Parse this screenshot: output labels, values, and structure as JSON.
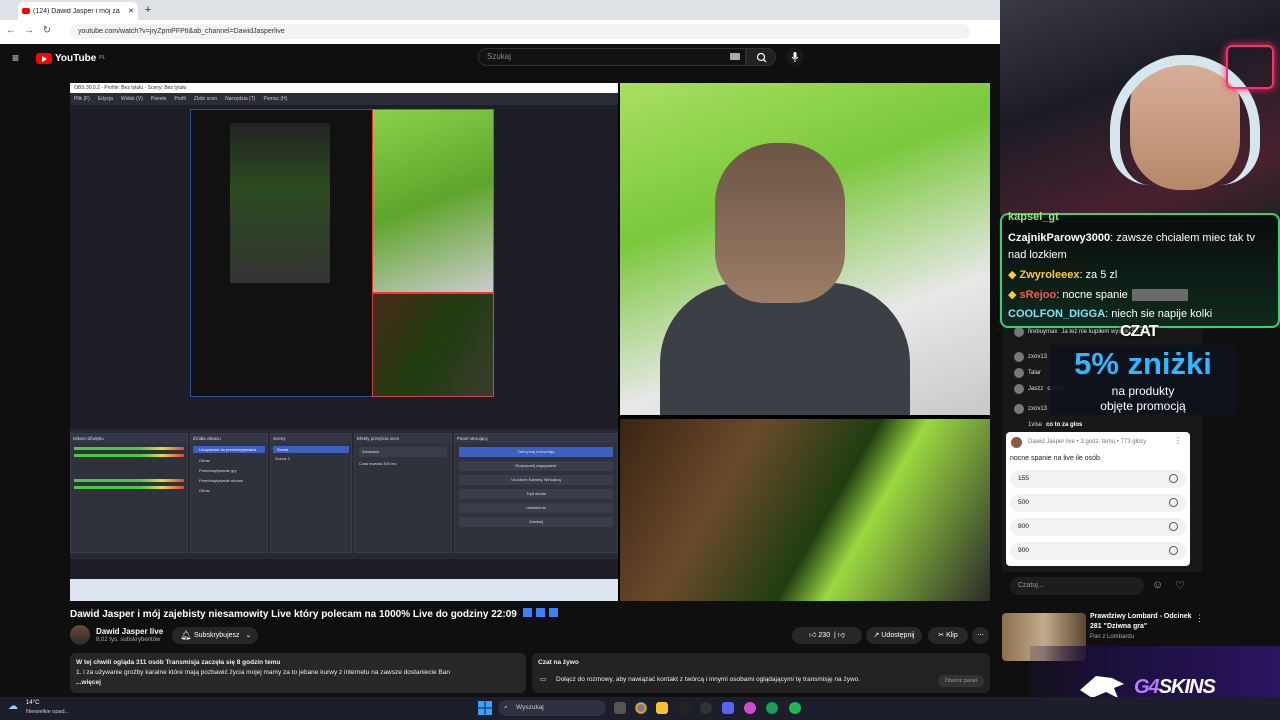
{
  "browser": {
    "tab_title": "(124) Dawid Jasper i mój za",
    "url": "youtube.com/watch?v=jryZpmPFPtI&ab_channel=DawidJasperlive"
  },
  "youtube": {
    "logo": "YouTube",
    "logo_country": "PL",
    "search_placeholder": "Szukaj"
  },
  "obs": {
    "title": "OBS 30.0.2 - Profile: Bez tytułu - Sceny: Bez tytułu",
    "menu": [
      "Plik (F)",
      "Edycja",
      "Widok (V)",
      "Panele",
      "Profil",
      "Zbiór scen",
      "Narzędzia (T)",
      "Pomoc (H)"
    ],
    "docks": [
      "Mikser dźwięku",
      "Źródła obrazu",
      "Sceny",
      "Efekty przejścia scen",
      "Panel sterujący"
    ],
    "scene_selected": "Scena",
    "scene_2": "Scena 3",
    "transition": "Zanikanie",
    "duration_label": "Czas trwania",
    "duration_value": "300 ms",
    "controls": [
      "Zatrzymaj transmisję",
      "Rozpocznij nagrywanie",
      "Uruchom Kamerę Wirtualną",
      "Tryb studia",
      "Ustawienia",
      "Zamknij"
    ],
    "sources": [
      "Urządzenie do przechwytywania",
      "Obraz",
      "Przechwytywanie gry",
      "Przechwytywanie ekranu",
      "Obraz"
    ]
  },
  "overlay_chat": {
    "lines": [
      {
        "name": "kapsel_gt",
        "text": "",
        "color": "#9be96b"
      },
      {
        "name": "CzajnikParowy3000",
        "text": ": zawsze chcialem miec tak tv",
        "color": "#ffffff"
      },
      {
        "name": "",
        "text": "nad lozkiem",
        "color": "#ffffff"
      },
      {
        "name": "Zwyroleeex",
        "text": ": za 5 zl",
        "color": "#ffcc33"
      },
      {
        "name": "sRejoo",
        "text": ": nocne spanie",
        "color": "#ff5555"
      },
      {
        "name": "COOLFON_DIGGA",
        "text": ": niech sie napije kolki",
        "color": "#7fe3ff"
      }
    ],
    "label": "CZAT"
  },
  "yt_chat_rows": [
    {
      "name": "firebuymax",
      "text": "Ja też nie kupiłem wysyłki 50 zł"
    },
    {
      "name": "zxov13",
      "text": ""
    },
    {
      "name": "Talar",
      "text": ""
    },
    {
      "name": "Jaszz",
      "text": "opozn"
    },
    {
      "name": "zxov13",
      "text": ""
    },
    {
      "name": "1vise",
      "text": "co to za glos"
    }
  ],
  "promo": {
    "big": "5% zniżki",
    "line1": "na produkty",
    "line2": "objęte promocją"
  },
  "poll": {
    "meta": "Dawid Jasper live • 3 godz. temu • 773 głosy",
    "question": "nocne spanie na live ile osób",
    "options": [
      "155",
      "500",
      "800",
      "900"
    ]
  },
  "chat_input_placeholder": "Czatuj...",
  "video": {
    "title": "Dawid Jasper i mój zajebisty niesamowity Live który polecam na 1000% Live do godziny 22:09",
    "channel": "Dawid Jasper live",
    "subscribers": "8,02 tys. subskrybentów",
    "subscribe_label": "Subskrybujesz",
    "likes": "230",
    "share": "Udostępnij",
    "clip": "Klip"
  },
  "description": {
    "line1": "W tej chwili ogląda 311 osób  Transmisja zaczęła się 8 godzin temu",
    "line2": "1. i za używanie groźby karalne które mają pozbawić życia mojej mamy  za to jebane kurwy z internetu na zawsze dostaniecie Ban",
    "more": "...więcej"
  },
  "live_chat_box": {
    "title": "Czat na żywo",
    "text": "Dołącz do rozmowy, aby nawiązać kontakt z twórcą i innymi osobami oglądającymi tę transmisję na żywo.",
    "button": "Otwórz panel"
  },
  "recommended": {
    "title1": "Prawdziwy Lombard - Odcinek",
    "title2": "281 \"Dziwna gra\"",
    "channel": "Pan z Lombardu"
  },
  "brand": {
    "prefix": "G4",
    "suffix": "SKINS"
  },
  "taskbar": {
    "temp": "14°C",
    "weather": "Niewielkie opad...",
    "search": "Wyszukaj"
  }
}
